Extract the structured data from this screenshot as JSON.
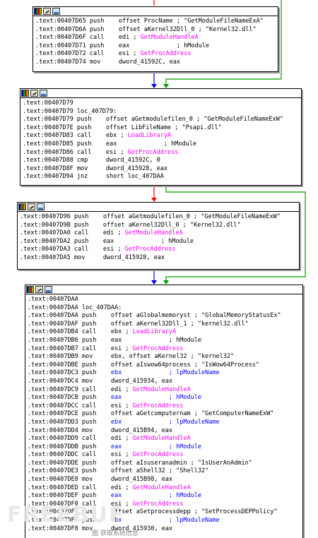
{
  "blocks": [
    {
      "lines": [
        {
          "a": ".text:00407D65 ",
          "m": "push",
          "o": "    offset ProcName ; \"GetModuleFileNameExA\"",
          "c": ""
        },
        {
          "a": ".text:00407D6A ",
          "m": "push",
          "o": "    offset aKernel32Dll_0 ; \"Kernel32.dll\"",
          "c": ""
        },
        {
          "a": ".text:00407D6F ",
          "m": "call",
          "o": "    edi ; ",
          "c": "GetModuleHandleA"
        },
        {
          "a": ".text:00407D71 ",
          "m": "push",
          "o": "    eax             ; hModule",
          "c": ""
        },
        {
          "a": ".text:00407D72 ",
          "m": "call",
          "o": "    esi ; ",
          "c": "GetProcAddress"
        },
        {
          "a": ".text:00407D74 ",
          "m": "mov",
          "o": "     dword_41592C, eax",
          "c": ""
        }
      ]
    },
    {
      "lines": [
        {
          "a": ".text:00407D79",
          "m": "",
          "o": "",
          "c": ""
        },
        {
          "a": ".text:00407D79 ",
          "m": "loc_407D79:",
          "o": "",
          "c": ""
        },
        {
          "a": ".text:00407D79 ",
          "m": "push",
          "o": "    offset aGetmodulefilen_0 ; \"GetModuleFileNameExW\"",
          "c": ""
        },
        {
          "a": ".text:00407D7E ",
          "m": "push",
          "o": "    offset LibFileName ; \"Psapi.dll\"",
          "c": ""
        },
        {
          "a": ".text:00407D83 ",
          "m": "call",
          "o": "    ebx ; ",
          "c": "LoadLibraryA"
        },
        {
          "a": ".text:00407D85 ",
          "m": "push",
          "o": "    eax             ; hModule",
          "c": ""
        },
        {
          "a": ".text:00407D86 ",
          "m": "call",
          "o": "    esi ; ",
          "c": "GetProcAddress"
        },
        {
          "a": ".text:00407D88 ",
          "m": "cmp",
          "o": "     dword_41592C, 0",
          "c": ""
        },
        {
          "a": ".text:00407D8F ",
          "m": "mov",
          "o": "     dword_415928, eax",
          "c": ""
        },
        {
          "a": ".text:00407D94 ",
          "m": "jnz",
          "o": "     short loc_407DAA",
          "c": ""
        }
      ]
    },
    {
      "lines": [
        {
          "a": ".text:00407D96 ",
          "m": "push",
          "o": "    offset aGetmodulefilen_0 ; \"GetModuleFileNameExW\"",
          "c": ""
        },
        {
          "a": ".text:00407D9B ",
          "m": "push",
          "o": "    offset aKernel32Dll_0 ; \"Kernel32.dll\"",
          "c": ""
        },
        {
          "a": ".text:00407DA0 ",
          "m": "call",
          "o": "    edi ; ",
          "c": "GetModuleHandleA"
        },
        {
          "a": ".text:00407DA2 ",
          "m": "push",
          "o": "    eax             ; hModule",
          "c": ""
        },
        {
          "a": ".text:00407DA3 ",
          "m": "call",
          "o": "    esi ; ",
          "c": "GetProcAddress"
        },
        {
          "a": ".text:00407DA5 ",
          "m": "mov",
          "o": "     dword_415928, eax",
          "c": ""
        }
      ]
    },
    {
      "lines": [
        {
          "a": ".text:00407DAA",
          "m": "",
          "o": "",
          "c": ""
        },
        {
          "a": ".text:00407DAA ",
          "m": "loc_407DAA:",
          "o": "",
          "c": ""
        },
        {
          "a": ".text:00407DAA ",
          "m": "push",
          "o": "    offset aGlobalmemoryst ; \"GlobalMemoryStatusEx\"",
          "c": ""
        },
        {
          "a": ".text:00407DAF ",
          "m": "push",
          "o": "    offset aKernel32Dll_1 ; \"kernel32.dll\"",
          "c": ""
        },
        {
          "a": ".text:00407DB4 ",
          "m": "call",
          "o": "    ebx ; ",
          "c": "LoadLibraryA"
        },
        {
          "a": ".text:00407DB6 ",
          "m": "push",
          "o": "    eax             ; hModule",
          "c": ""
        },
        {
          "a": ".text:00407DB7 ",
          "m": "call",
          "o": "    esi ; ",
          "c": "GetProcAddress"
        },
        {
          "a": ".text:00407DB9 ",
          "m": "mov",
          "o": "     ebx, offset aKernel32 ; \"kernel32\"",
          "c": ""
        },
        {
          "a": ".text:00407DBE ",
          "m": "push",
          "o": "    offset aIswow64process ; \"IsWow64Process\"",
          "c": ""
        },
        {
          "a": ".text:00407DC3 ",
          "m": "push",
          "o": "    ebx             ; lpModuleName",
          "c": "",
          "blue": true
        },
        {
          "a": ".text:00407DC4 ",
          "m": "mov",
          "o": "     dword_415934, eax",
          "c": ""
        },
        {
          "a": ".text:00407DC9 ",
          "m": "call",
          "o": "    edi ; ",
          "c": "GetModuleHandleA"
        },
        {
          "a": ".text:00407DCB ",
          "m": "push",
          "o": "    eax             ; hModule",
          "c": "",
          "blue": true
        },
        {
          "a": ".text:00407DCC ",
          "m": "call",
          "o": "    esi ; ",
          "c": "GetProcAddress"
        },
        {
          "a": ".text:00407DCE ",
          "m": "push",
          "o": "    offset aGetcomputernam ; \"GetComputerNameExW\"",
          "c": ""
        },
        {
          "a": ".text:00407DD3 ",
          "m": "push",
          "o": "    ebx             ; lpModuleName",
          "c": "",
          "blue": true
        },
        {
          "a": ".text:00407DD4 ",
          "m": "mov",
          "o": "     dword_415B94, eax",
          "c": ""
        },
        {
          "a": ".text:00407DD9 ",
          "m": "call",
          "o": "    edi ; ",
          "c": "GetModuleHandleA"
        },
        {
          "a": ".text:00407DDB ",
          "m": "push",
          "o": "    eax             ; hModule",
          "c": "",
          "blue": true
        },
        {
          "a": ".text:00407DDC ",
          "m": "call",
          "o": "    esi ; ",
          "c": "GetProcAddress"
        },
        {
          "a": ".text:00407DDE ",
          "m": "push",
          "o": "    offset aIsuseranadmin ; \"IsUserAnAdmin\"",
          "c": ""
        },
        {
          "a": ".text:00407DE3 ",
          "m": "push",
          "o": "    offset aShell32 ; \"Shell32\"",
          "c": ""
        },
        {
          "a": ".text:00407DE8 ",
          "m": "mov",
          "o": "     dword_415B98, eax",
          "c": ""
        },
        {
          "a": ".text:00407DED ",
          "m": "call",
          "o": "    edi ; ",
          "c": "GetModuleHandleA"
        },
        {
          "a": ".text:00407DEF ",
          "m": "push",
          "o": "    eax             ; hModule",
          "c": "",
          "blue": true
        },
        {
          "a": ".text:00407DF0 ",
          "m": "call",
          "o": "    esi ; ",
          "c": "GetProcAddress"
        },
        {
          "a": ".text:00407DF2 ",
          "m": "push",
          "o": "    offset aSetprocessdepp ; \"SetProcessDEPPolicy\"",
          "c": ""
        },
        {
          "a": ".text:00407DF7 ",
          "m": "push",
          "o": "    ebx             ; lpModuleName",
          "c": "",
          "blue": true
        },
        {
          "a": ".text:00407DF8 ",
          "m": "mov",
          "o": "     dword_415930, eax",
          "c": ""
        }
      ]
    }
  ],
  "caption": "图          获取系统信息",
  "watermark": "FREEBUF",
  "colors": {
    "pink": "#ff00ff",
    "blue": "#0000ff",
    "edge_blue": "#0000ff",
    "edge_red": "#ff0000",
    "edge_green": "#00a000"
  }
}
